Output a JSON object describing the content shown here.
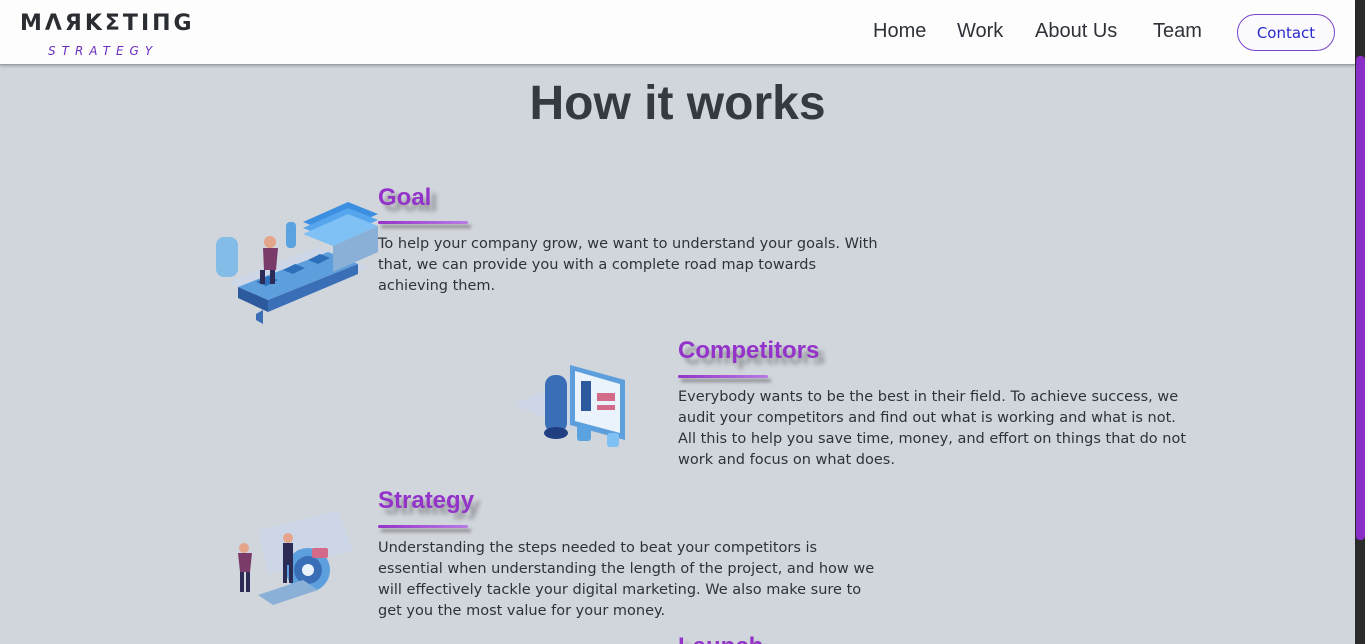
{
  "logo": {
    "main": "MΛЯKΣTIПG",
    "sub": "STRATEGY"
  },
  "nav": {
    "home": "Home",
    "work": "Work",
    "about": "About Us",
    "team": "Team",
    "contact": "Contact"
  },
  "page": {
    "title": "How it works"
  },
  "sections": [
    {
      "title": "Goal",
      "text": "To help your company grow, we want to understand your goals. With that, we can provide you with a complete road map towards achieving them.",
      "icon": "goal-illustration-icon"
    },
    {
      "title": "Competitors",
      "text": "Everybody wants to be the best in their field. To achieve success, we audit your competitors and find out what is working and what is not. All this to help you save time, money, and effort on things that do not work and focus on what does.",
      "icon": "competitors-illustration-icon"
    },
    {
      "title": "Strategy",
      "text": "Understanding the steps needed to beat your competitors is essential when understanding the length of the project, and how we will effectively tackle your digital marketing. We also make sure to get you the most value for your money.",
      "icon": "strategy-illustration-icon"
    },
    {
      "title": "Launch",
      "text": "",
      "icon": ""
    }
  ],
  "colors": {
    "accent": "#9433c9",
    "background": "#d1d5dc",
    "header": "#fdfdfd",
    "contact_text": "#2a2ac8"
  }
}
